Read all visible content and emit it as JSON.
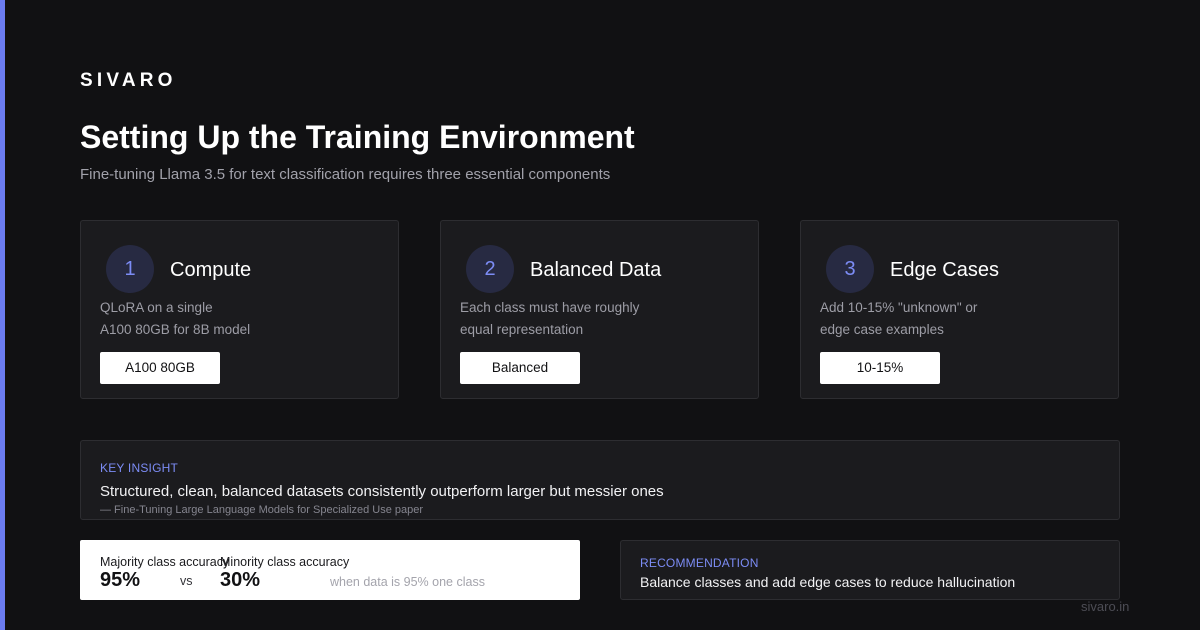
{
  "brand": "SIVARO",
  "title": "Setting Up the Training Environment",
  "subtitle": "Fine-tuning Llama 3.5 for text classification requires three essential components",
  "colors": {
    "accent": "#6b7cf0",
    "background": "#111113",
    "card": "#1b1b1e",
    "number_circle": "#272a42"
  },
  "cards": [
    {
      "number": "1",
      "title": "Compute",
      "desc_lines": [
        "QLoRA on a single",
        "A100 80GB for 8B model"
      ],
      "badge": "A100 80GB"
    },
    {
      "number": "2",
      "title": "Balanced Data",
      "desc_lines": [
        "Each class must have roughly",
        "equal representation"
      ],
      "badge": "Balanced"
    },
    {
      "number": "3",
      "title": "Edge Cases",
      "desc_lines": [
        "Add 10-15% \"unknown\" or",
        "edge case examples"
      ],
      "badge": "10-15%"
    }
  ],
  "insight": {
    "kicker": "KEY INSIGHT",
    "quote": "Structured, clean, balanced datasets consistently outperform larger but messier ones",
    "source": "— Fine-Tuning Large Language Models for Specialized Use paper"
  },
  "stats": {
    "majority_label": "Majority class accuracy",
    "majority_value": "95%",
    "vs": "vs",
    "minority_label": "Minority class accuracy",
    "minority_value": "30%",
    "note": "when data is 95% one class"
  },
  "recommendation": {
    "kicker": "RECOMMENDATION",
    "text": "Balance classes and add edge cases to reduce hallucination"
  },
  "footer": "sivaro.in"
}
